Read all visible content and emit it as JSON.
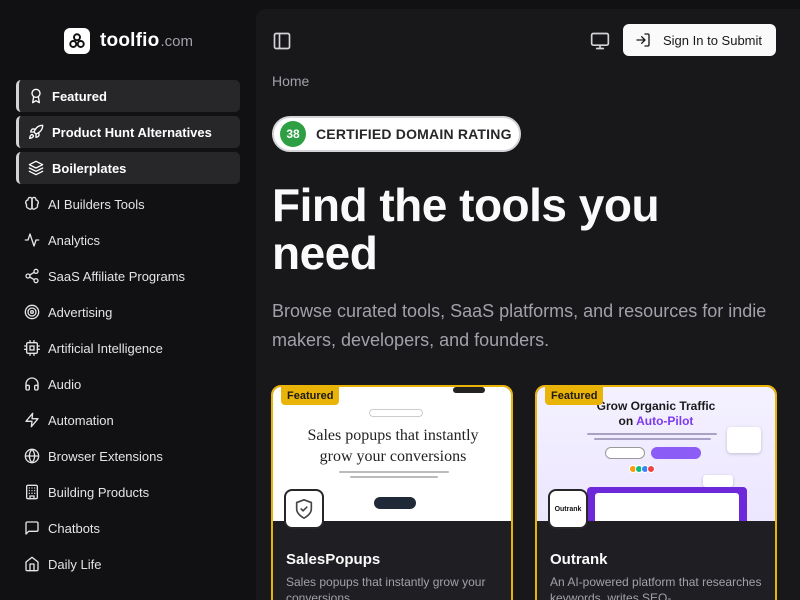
{
  "brand": {
    "name": "toolfio",
    "tld": ".com"
  },
  "sidebar": {
    "pinned": [
      {
        "label": "Featured",
        "icon": "award-icon"
      },
      {
        "label": "Product Hunt Alternatives",
        "icon": "rocket-icon"
      },
      {
        "label": "Boilerplates",
        "icon": "layers-icon"
      }
    ],
    "categories": [
      {
        "label": "AI Builders Tools",
        "icon": "brain-icon"
      },
      {
        "label": "Analytics",
        "icon": "activity-icon"
      },
      {
        "label": "SaaS Affiliate Programs",
        "icon": "share-icon"
      },
      {
        "label": "Advertising",
        "icon": "target-icon"
      },
      {
        "label": "Artificial Intelligence",
        "icon": "cpu-icon"
      },
      {
        "label": "Audio",
        "icon": "headphones-icon"
      },
      {
        "label": "Automation",
        "icon": "zap-icon"
      },
      {
        "label": "Browser Extensions",
        "icon": "globe-icon"
      },
      {
        "label": "Building Products",
        "icon": "building-icon"
      },
      {
        "label": "Chatbots",
        "icon": "message-square-icon"
      },
      {
        "label": "Daily Life",
        "icon": "home-icon"
      }
    ]
  },
  "header": {
    "signin_label": "Sign In to Submit"
  },
  "breadcrumb": "Home",
  "badge": {
    "score": "38",
    "label": "CERTIFIED DOMAIN RATING",
    "color": "#2ea043"
  },
  "hero": {
    "title": "Find the tools you need",
    "subtitle": "Browse curated tools, SaaS platforms, and resources for indie makers, developers, and founders."
  },
  "accent": "#eab308",
  "cards": [
    {
      "tag": "Featured",
      "name": "SalesPopups",
      "description": "Sales popups that instantly grow your conversions",
      "screenshot_headline": "Sales popups that instantly grow your conversions"
    },
    {
      "tag": "Featured",
      "name": "Outrank",
      "description": "An AI-powered platform that researches keywords, writes SEO-",
      "screenshot_headline_1": "Grow Organic Traffic",
      "screenshot_headline_2a": "on ",
      "screenshot_headline_2b": "Auto-Pilot",
      "logo_text": "Outrank"
    }
  ]
}
